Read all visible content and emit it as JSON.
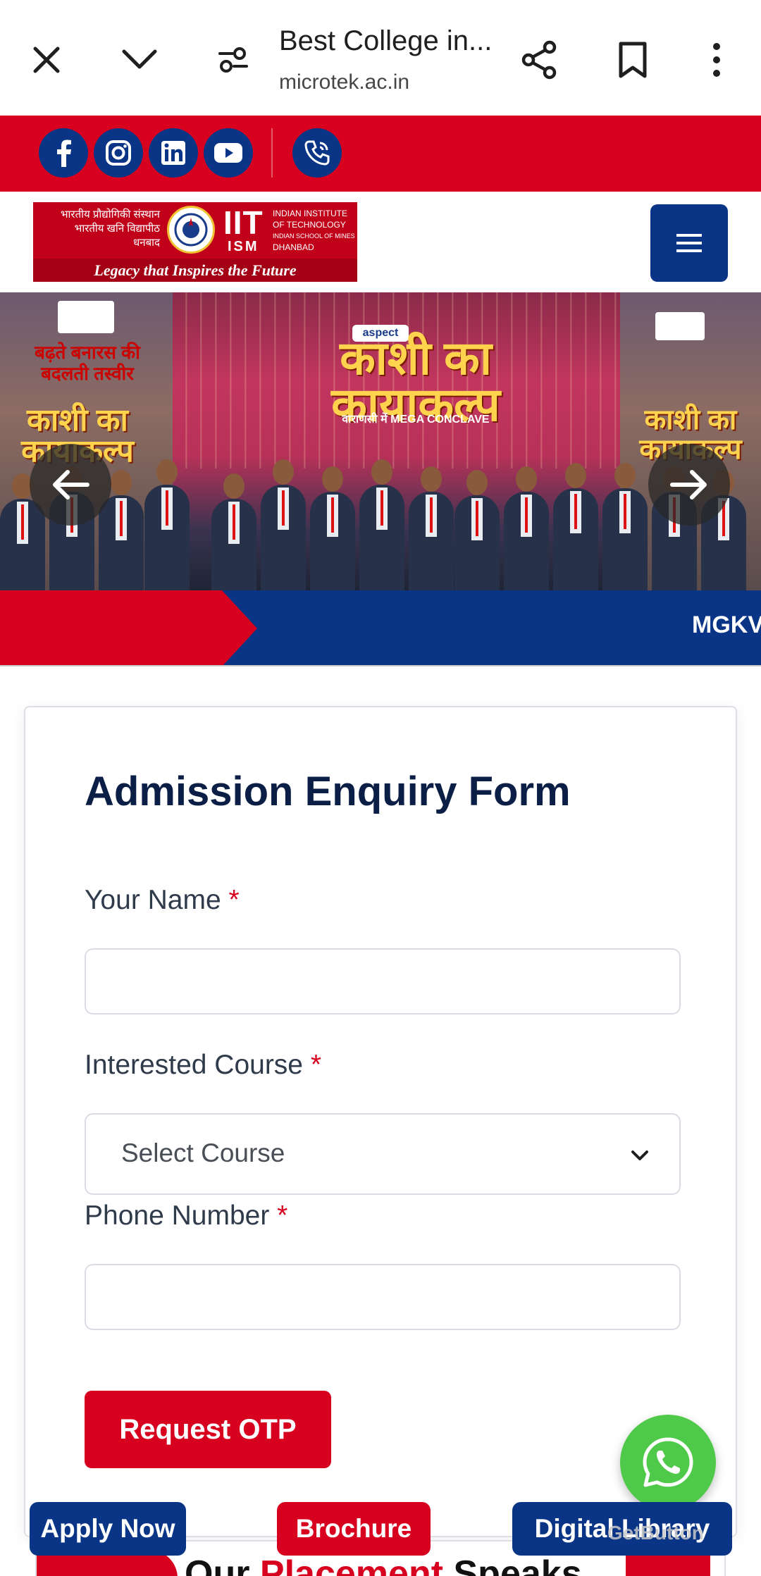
{
  "browser": {
    "title": "Best College in...",
    "url": "microtek.ac.in"
  },
  "social": {
    "icons": [
      "facebook-icon",
      "instagram-icon",
      "linkedin-icon",
      "youtube-icon",
      "phone-icon"
    ],
    "brand_color": "#d7001f",
    "icon_bg": "#0a3586"
  },
  "logo": {
    "hindi_line1": "भारतीय प्रौद्योगिकी संस्थान",
    "hindi_line2": "भारतीय खनि विद्यापीठ",
    "hindi_line3": "धनबाद",
    "iit": "IIT",
    "ism": "ISM",
    "eng_line1": "INDIAN INSTITUTE",
    "eng_line2": "OF TECHNOLOGY",
    "eng_line3": "INDIAN SCHOOL OF MINES",
    "eng_line4": "DHANBAD",
    "tagline": "Legacy that Inspires the Future"
  },
  "hero": {
    "aspect": "aspect",
    "title": "काशी का कायाकल्प",
    "subtitle": "वाराणसी में MEGA CONCLAVE",
    "left_text": "बढ़ते बनारस की बदलती तस्वीर"
  },
  "ticker": {
    "text": "MGKV"
  },
  "form": {
    "title": "Admission Enquiry Form",
    "name_label": "Your Name",
    "course_label": "Interested Course",
    "course_selected": "Select Course",
    "phone_label": "Phone Number",
    "required_mark": "*",
    "submit_label": "Request OTP"
  },
  "placement": {
    "title_part1": "Our ",
    "title_part2": "Placement",
    "title_part3": " Speaks"
  },
  "floating": {
    "apply_label": "Apply Now",
    "brochure_label": "Brochure",
    "digital_label": "Digital Library",
    "getbutton": "GetButton"
  },
  "colors": {
    "primary_red": "#d7001f",
    "primary_blue": "#0a3586",
    "whatsapp_green": "#4fc94a"
  }
}
